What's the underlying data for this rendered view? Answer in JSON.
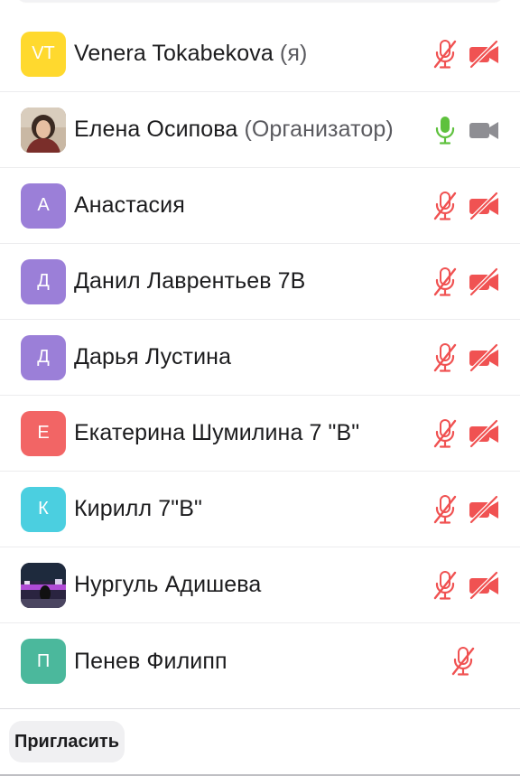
{
  "participants": [
    {
      "name": "Venera Tokabekova",
      "role": "(я)",
      "avatar_initials": "VT",
      "avatar_color": "#ffd92e",
      "photo": false,
      "mic": "muted",
      "cam": "off"
    },
    {
      "name": "Елена Осипова",
      "role": "(Организатор)",
      "avatar_initials": "",
      "avatar_color": "#8a6d5e",
      "photo": true,
      "mic": "on",
      "cam": "available"
    },
    {
      "name": "Анастасия",
      "role": "",
      "avatar_initials": "А",
      "avatar_color": "#9b7fd8",
      "photo": false,
      "mic": "muted",
      "cam": "off"
    },
    {
      "name": "Данил Лаврентьев 7В",
      "role": "",
      "avatar_initials": "Д",
      "avatar_color": "#9b7fd8",
      "photo": false,
      "mic": "muted",
      "cam": "off"
    },
    {
      "name": "Дарья Лустина",
      "role": "",
      "avatar_initials": "Д",
      "avatar_color": "#9b7fd8",
      "photo": false,
      "mic": "muted",
      "cam": "off"
    },
    {
      "name": "Екатерина Шумилина 7 \"В\"",
      "role": "",
      "avatar_initials": "Е",
      "avatar_color": "#f26565",
      "photo": false,
      "mic": "muted",
      "cam": "off"
    },
    {
      "name": "Кирилл 7\"В\"",
      "role": "",
      "avatar_initials": "К",
      "avatar_color": "#4bcfe0",
      "photo": false,
      "mic": "muted",
      "cam": "off"
    },
    {
      "name": "Нургуль Адишева",
      "role": "",
      "avatar_initials": "",
      "avatar_color": "#3a3350",
      "photo": true,
      "mic": "muted",
      "cam": "off"
    },
    {
      "name": "Пенев Филипп",
      "role": "",
      "avatar_initials": "П",
      "avatar_color": "#4bb89c",
      "photo": false,
      "mic": "muted",
      "cam": "none"
    }
  ],
  "footer": {
    "invite_label": "Пригласить"
  },
  "colors": {
    "muted_red": "#f05252",
    "mic_green": "#5ec13d",
    "cam_gray": "#8e8e93"
  },
  "icons": {
    "mic_muted": "mic-muted-icon",
    "mic_on": "mic-icon",
    "cam_off": "video-off-icon",
    "cam_on": "video-icon"
  }
}
